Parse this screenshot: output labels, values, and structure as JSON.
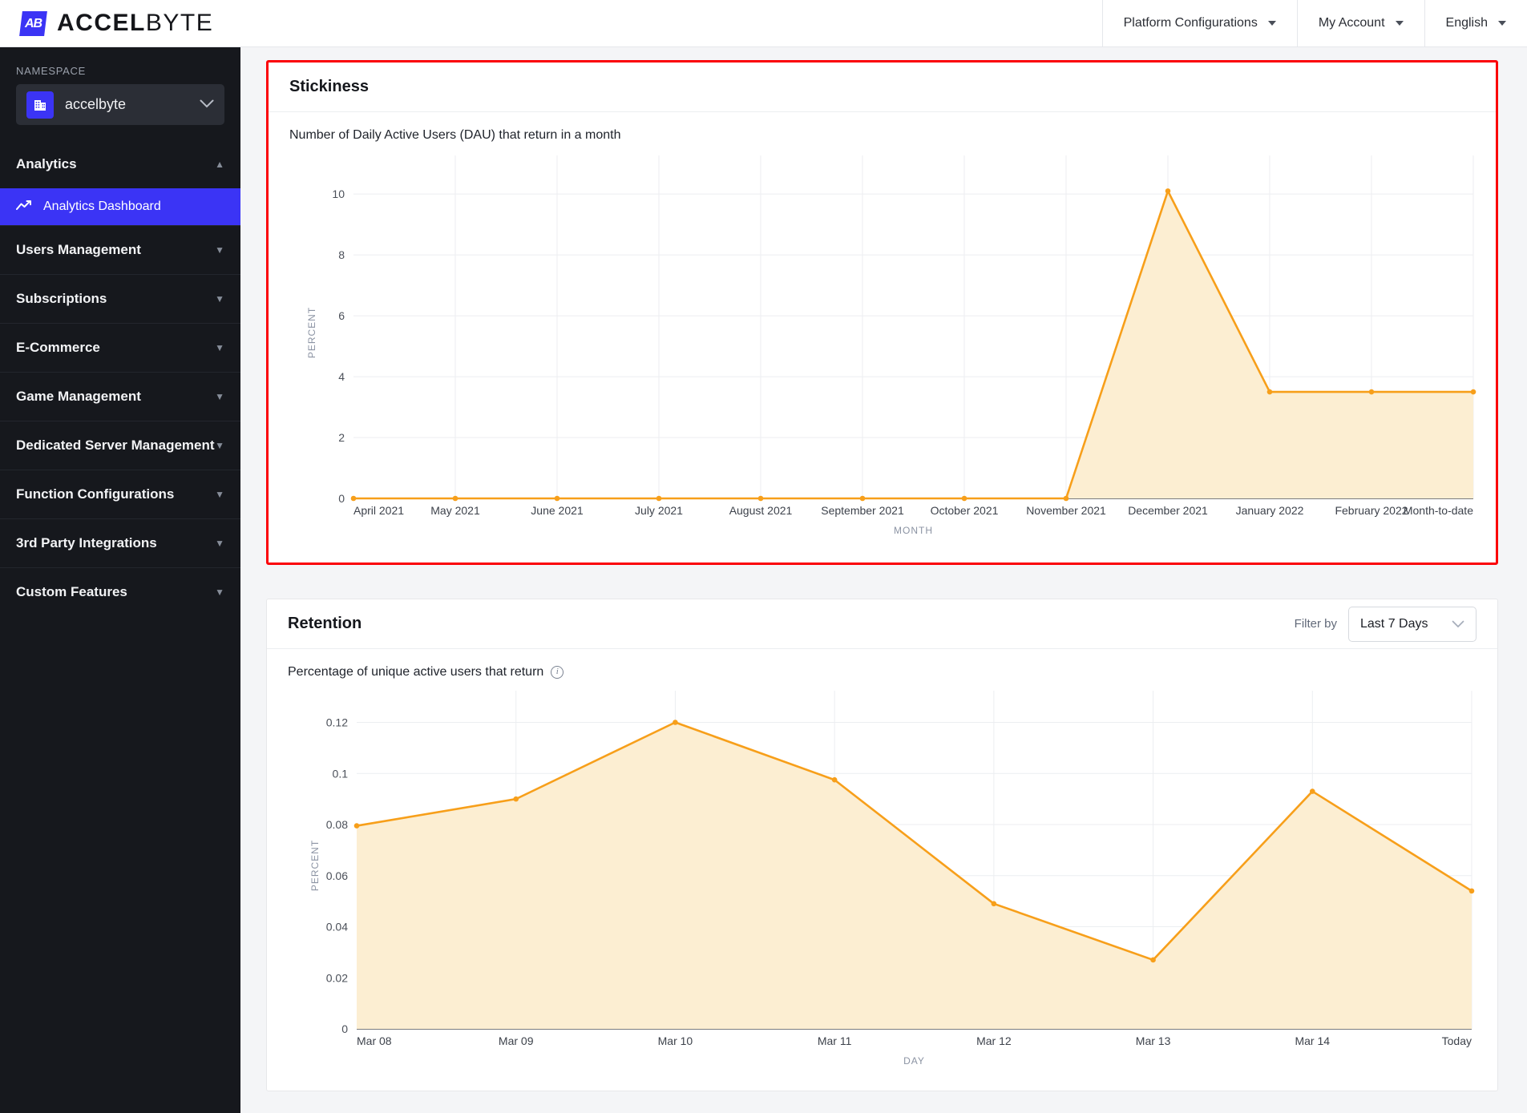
{
  "brand": {
    "name_a": "ACCEL",
    "name_b": "BYTE",
    "mark": "AB"
  },
  "topbar": {
    "items": [
      {
        "label": "Platform Configurations",
        "icon": "chevron-down-icon"
      },
      {
        "label": "My Account",
        "icon": "chevron-down-icon"
      },
      {
        "label": "English",
        "icon": "chevron-down-icon"
      }
    ]
  },
  "sidebar": {
    "namespace_label": "NAMESPACE",
    "namespace_value": "accelbyte",
    "namespace_icon": "building-icon",
    "sections": [
      {
        "label": "Analytics",
        "expanded": true,
        "icon": "chevron-up-icon",
        "items": [
          {
            "label": "Analytics Dashboard",
            "icon": "trending-up-icon",
            "active": true
          }
        ]
      },
      {
        "label": "Users Management",
        "expanded": false,
        "icon": "chevron-down-icon",
        "items": []
      },
      {
        "label": "Subscriptions",
        "expanded": false,
        "icon": "chevron-down-icon",
        "items": []
      },
      {
        "label": "E-Commerce",
        "expanded": false,
        "icon": "chevron-down-icon",
        "items": []
      },
      {
        "label": "Game Management",
        "expanded": false,
        "icon": "chevron-down-icon",
        "items": []
      },
      {
        "label": "Dedicated Server Management",
        "expanded": false,
        "icon": "chevron-down-icon",
        "items": []
      },
      {
        "label": "Function Configurations",
        "expanded": false,
        "icon": "chevron-down-icon",
        "items": []
      },
      {
        "label": "3rd Party Integrations",
        "expanded": false,
        "icon": "chevron-down-icon",
        "items": []
      },
      {
        "label": "Custom Features",
        "expanded": false,
        "icon": "chevron-down-icon",
        "items": []
      }
    ]
  },
  "stickiness": {
    "title": "Stickiness",
    "caption": "Number of Daily Active Users (DAU) that return in a month"
  },
  "retention": {
    "title": "Retention",
    "caption": "Percentage of unique active users that return",
    "info_icon": "info-icon",
    "filter_label": "Filter by",
    "filter_value": "Last 7 Days",
    "filter_icon": "chevron-down-icon"
  },
  "colors": {
    "accent": "#3b34f5",
    "series_line": "#f79f1a",
    "series_fill": "#fceed2",
    "highlight_border": "#fb0007",
    "sidebar_bg": "#16181d"
  },
  "chart_data": [
    {
      "id": "stickiness",
      "type": "area",
      "title": "Stickiness",
      "subtitle": "Number of Daily Active Users (DAU) that return in a month",
      "xlabel": "MONTH",
      "ylabel": "PERCENT",
      "categories": [
        "April 2021",
        "May 2021",
        "June 2021",
        "July 2021",
        "August 2021",
        "September 2021",
        "October 2021",
        "November 2021",
        "December 2021",
        "January 2022",
        "February 2022",
        "Month-to-date"
      ],
      "values": [
        0,
        0,
        0,
        0,
        0,
        0,
        0,
        0,
        10.1,
        3.5,
        3.5,
        3.5
      ],
      "yticks": [
        0,
        2,
        4,
        6,
        8,
        10
      ],
      "ylim": [
        0,
        10.9
      ],
      "grid": true,
      "legend": "none"
    },
    {
      "id": "retention",
      "type": "area",
      "title": "Retention",
      "subtitle": "Percentage of unique active users that return",
      "xlabel": "DAY",
      "ylabel": "PERCENT",
      "categories": [
        "Mar 08",
        "Mar 09",
        "Mar 10",
        "Mar 11",
        "Mar 12",
        "Mar 13",
        "Mar 14",
        "Today"
      ],
      "values": [
        0.0795,
        0.09,
        0.12,
        0.0975,
        0.049,
        0.027,
        0.093,
        0.054
      ],
      "yticks": [
        0,
        0.02,
        0.04,
        0.06,
        0.08,
        0.1,
        0.12
      ],
      "ytick_labels": [
        "0",
        "0.02",
        "0.04",
        "0.06",
        "0.08",
        "0.1",
        "0.12"
      ],
      "ylim": [
        0,
        0.128
      ],
      "grid": true,
      "legend": "none"
    }
  ]
}
